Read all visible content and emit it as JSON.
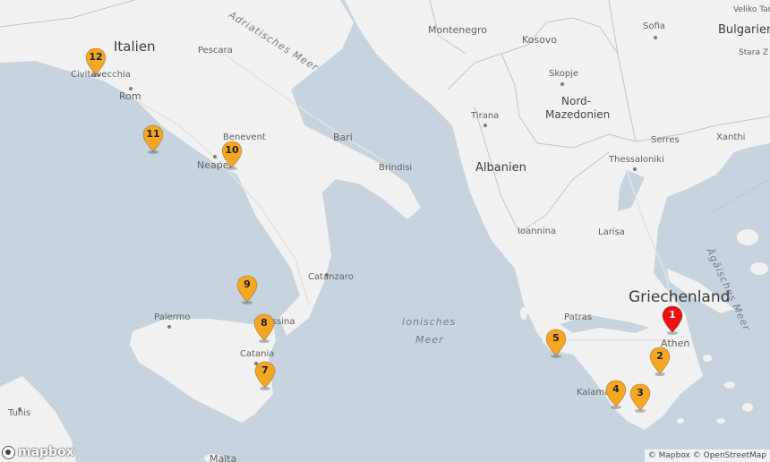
{
  "colors": {
    "water": "#c7d4df",
    "land": "#f1f1f1",
    "border": "#c0c0c0",
    "marker": "#f5a623",
    "marker_active": "#ee1111"
  },
  "countries": {
    "italien": "Italien",
    "montenegro": "Montenegro",
    "kosovo": "Kosovo",
    "albanien": "Albanien",
    "nord1": "Nord-",
    "nord2": "Mazedonien",
    "griechenland": "Griechenland",
    "bulgarien": "Bulgarier"
  },
  "cities": {
    "civitavecchia": "Civitavecchia",
    "rom": "Rom",
    "pescara": "Pescara",
    "benevent": "Benevent",
    "neapel": "Neapel",
    "bari": "Bari",
    "brindisi": "Brindisi",
    "catanzaro": "Catanzaro",
    "palermo": "Palermo",
    "messina": "Messina",
    "catania": "Catania",
    "tunis": "Tunis",
    "malta": "Malta",
    "tirana": "Tirana",
    "skopje": "Skopje",
    "sofia": "Sofia",
    "veliko": "Veliko Tar",
    "stara": "Stara Z",
    "serres": "Serres",
    "xanthi": "Xanthi",
    "thessaloniki": "Thessaloniki",
    "ioannina": "Ioannina",
    "larisa": "Larisa",
    "patras": "Patras",
    "kalamata": "Kalama",
    "athen": "Athen"
  },
  "waters": {
    "adria": "Adriatisches Meer",
    "ionisch1": "Ionisches",
    "ionisch2": "Meer",
    "aegaeis": "Ägäisches Meer"
  },
  "markers": [
    "1",
    "2",
    "3",
    "4",
    "5",
    "7",
    "8",
    "9",
    "10",
    "11",
    "12"
  ],
  "logo": {
    "text": "mapbox",
    "icon": "mapbox-logo-icon"
  },
  "attribution": "© Mapbox © OpenStreetMap"
}
